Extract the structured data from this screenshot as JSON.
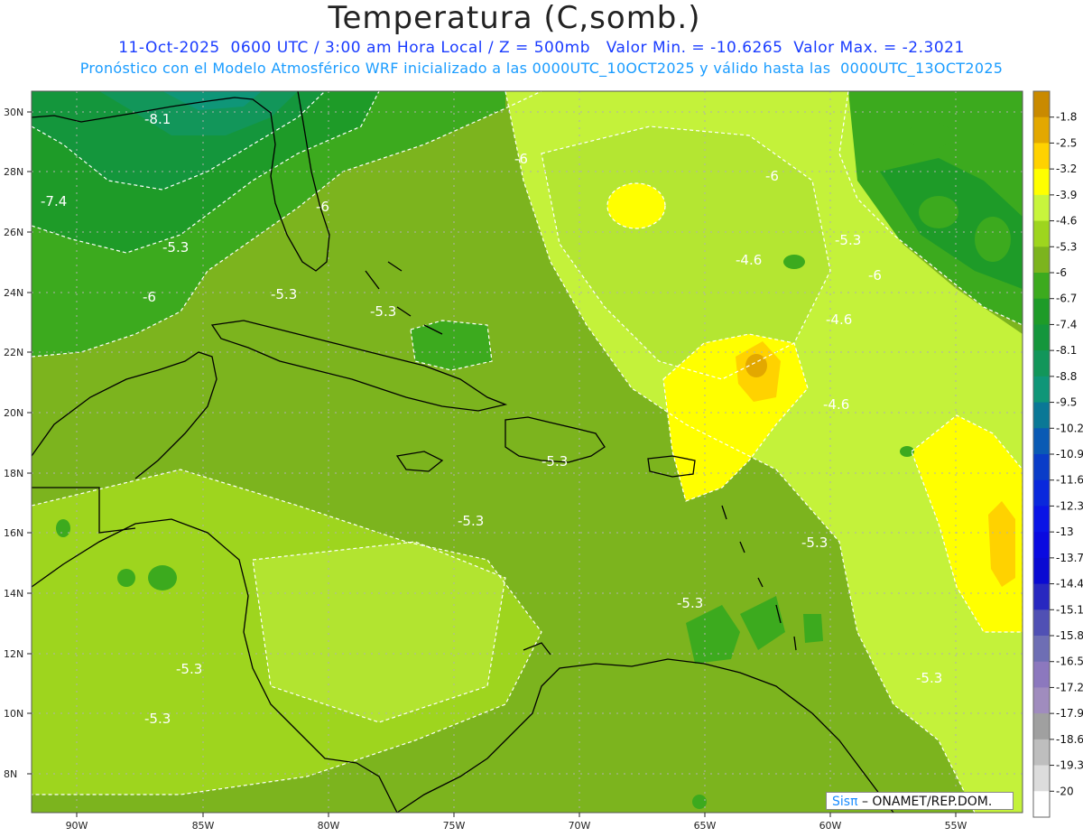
{
  "header": {
    "title": "Temperatura (C,somb.)",
    "line1": "11-Oct-2025  0600 UTC / 3:00 am Hora Local / Z = 500mb   Valor Min. = -10.6265  Valor Max. = -2.3021",
    "line2": "Pronóstico con el Modelo Atmosférico WRF inicializado a las 0000UTC_10OCT2025 y válido hasta las  0000UTC_13OCT2025"
  },
  "axes": {
    "lat_labels": [
      "30N",
      "28N",
      "26N",
      "24N",
      "22N",
      "20N",
      "18N",
      "16N",
      "14N",
      "12N",
      "10N",
      "8N"
    ],
    "lon_labels": [
      "90W",
      "85W",
      "80W",
      "75W",
      "70W",
      "65W",
      "60W",
      "55W"
    ]
  },
  "contour_labels": [
    "-8.1",
    "-6",
    "-7.4",
    "-6",
    "-6",
    "-5.3",
    "-5.3",
    "-6",
    "-5.3",
    "-4.6",
    "-6",
    "-5.3",
    "-4.6",
    "-4.6",
    "-5.3",
    "-5.3",
    "-5.3",
    "-5.3",
    "-5.3",
    "-5.3",
    "-5.3"
  ],
  "colorbar": {
    "labels": [
      "-1.8",
      "-2.5",
      "-3.2",
      "-3.9",
      "-4.6",
      "-5.3",
      "-6",
      "-6.7",
      "-7.4",
      "-8.1",
      "-8.8",
      "-9.5",
      "-10.2",
      "-10.9",
      "-11.6",
      "-12.3",
      "-13",
      "-13.7",
      "-14.4",
      "-15.1",
      "-15.8",
      "-16.5",
      "-17.2",
      "-17.9",
      "-18.6",
      "-19.3",
      "-20"
    ],
    "colors": [
      "#c98a00",
      "#e3a800",
      "#ffd200",
      "#ffff00",
      "#c8f53c",
      "#9ed51e",
      "#7cb41e",
      "#3caa1e",
      "#1e9b28",
      "#14963c",
      "#12965a",
      "#0f9678",
      "#0a7896",
      "#0a5ab4",
      "#0a3cc8",
      "#0a28dc",
      "#0a14e6",
      "#0a0ae0",
      "#0a0ad2",
      "#2828c0",
      "#5050b4",
      "#6e6eb4",
      "#8c78be",
      "#a08cbe",
      "#a0a0a0",
      "#bebebe",
      "#dcdcdc",
      "#ffffff"
    ]
  },
  "credit": {
    "brand": "Sisπ",
    "org": " – ONAMET/REP.DOM."
  }
}
